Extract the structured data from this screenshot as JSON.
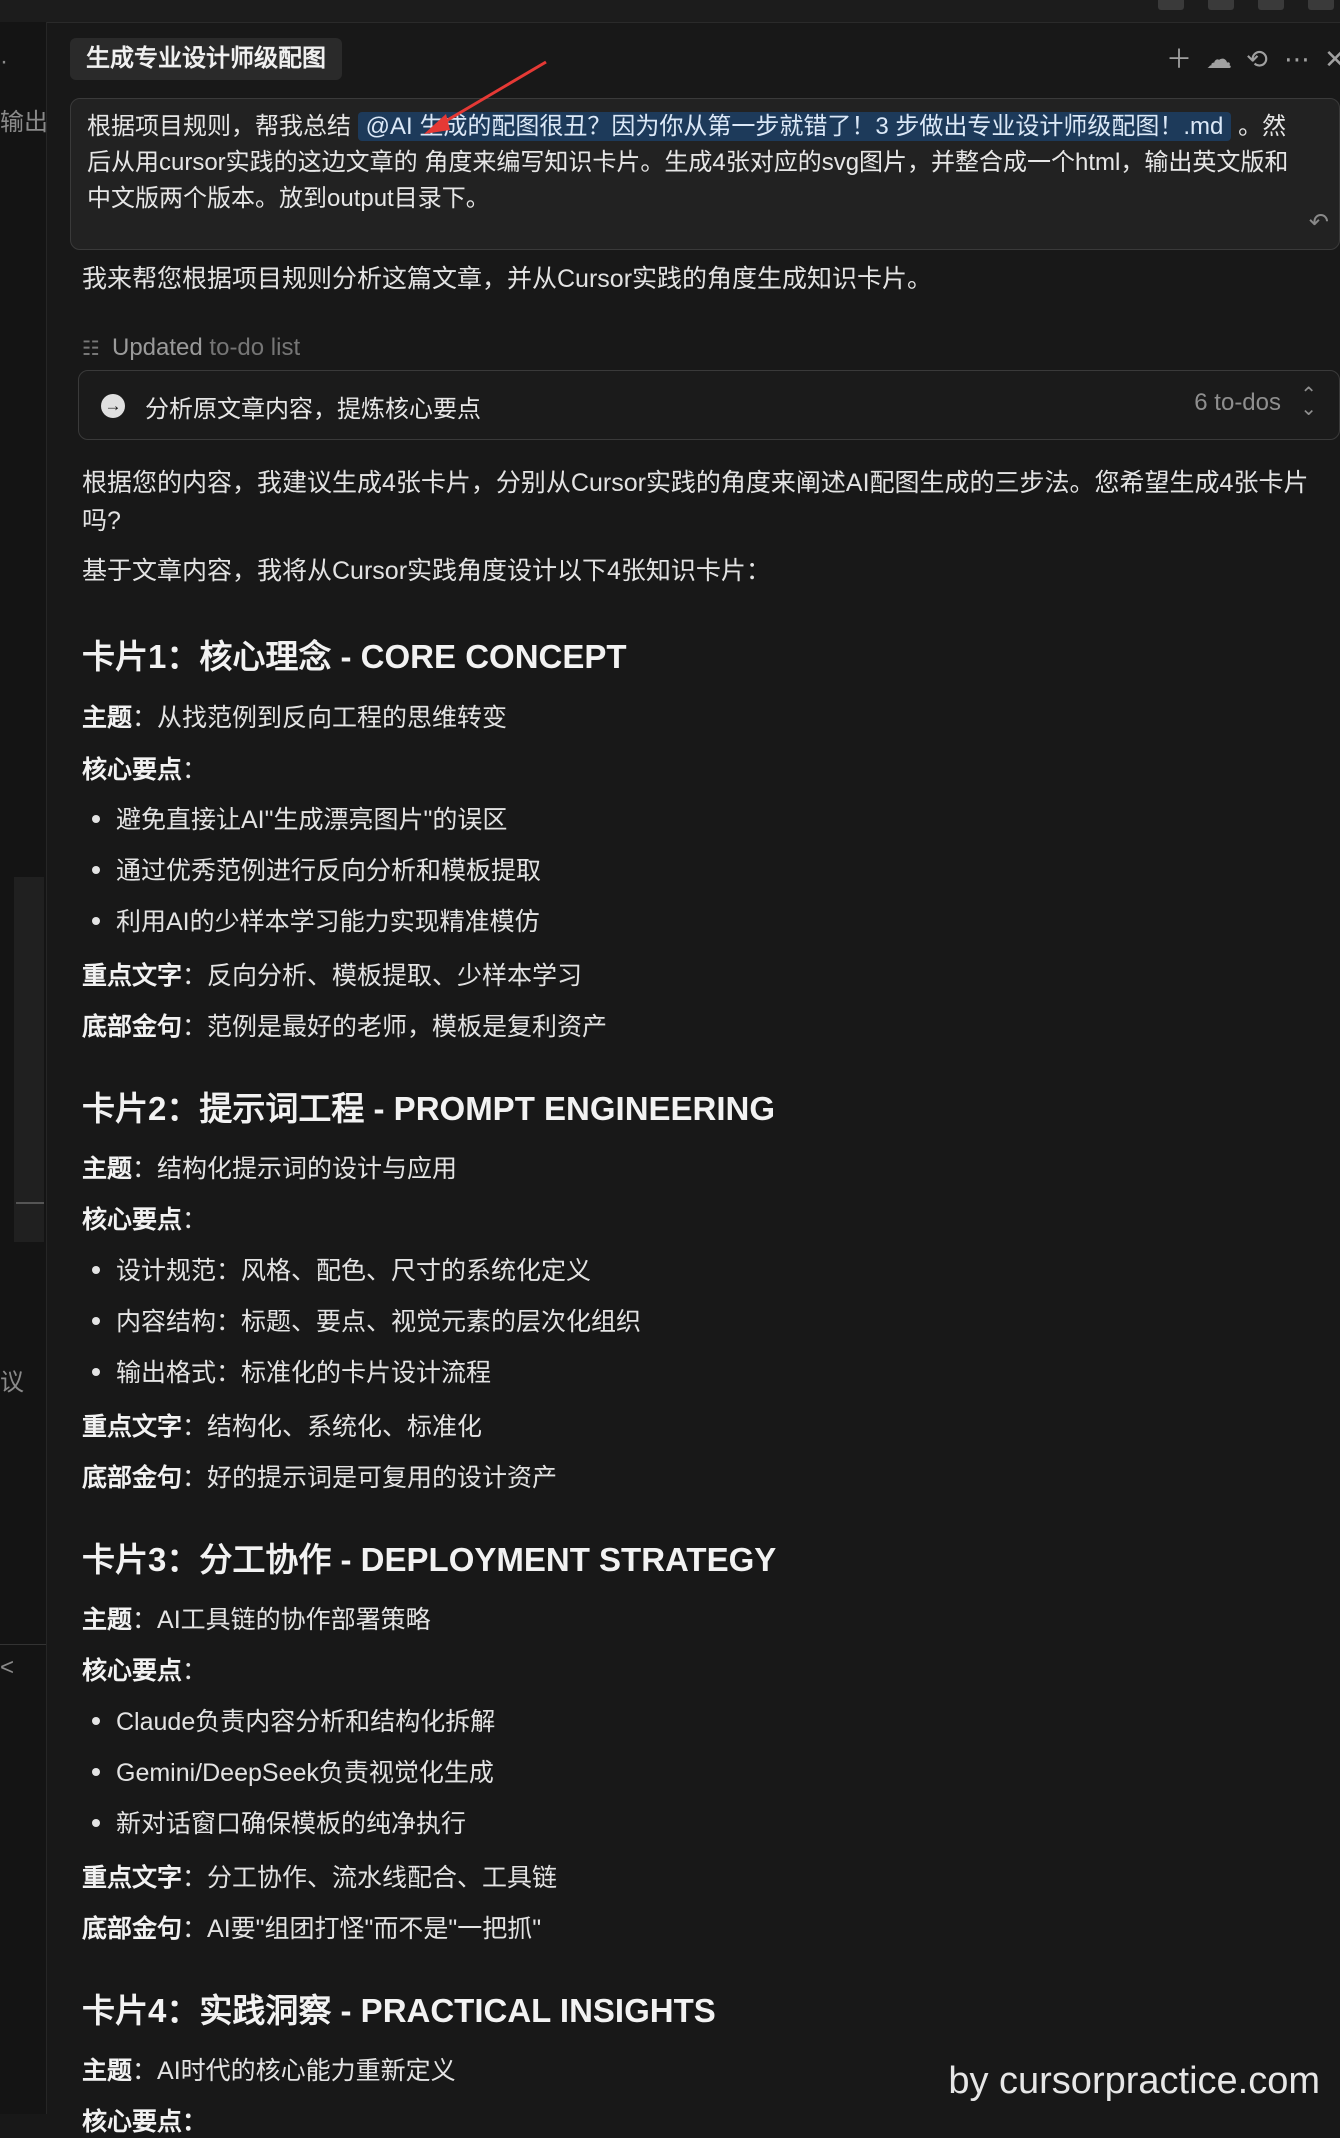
{
  "left_fragments": [
    "·",
    "输出",
    "议",
    "<"
  ],
  "tab_title": "生成专业设计师级配图",
  "header_icons": [
    "plus-icon",
    "cloud-icon",
    "history-icon",
    "more-icon",
    "close-icon"
  ],
  "user_message": {
    "before": "根据项目规则，帮我总结 ",
    "mention": "@AI 生成的配图很丑？因为你从第一步就错了！3 步做出专业设计师级配图！.md",
    "after": " 。然后从用cursor实践的这边文章的 角度来编写知识卡片。生成4张对应的svg图片，并整合成一个html，输出英文版和中文版两个版本。放到output目录下。"
  },
  "reply_intro": "我来帮您根据项目规则分析这篇文章，并从Cursor实践的角度生成知识卡片。",
  "updated": {
    "label": "Updated",
    "target": "to-do list"
  },
  "todo": {
    "label": "分析原文章内容，提炼核心要点",
    "count": "6 to-dos"
  },
  "para1": "根据您的内容，我建议生成4张卡片，分别从Cursor实践的角度来阐述AI配图生成的三步法。您希望生成4张卡片吗?",
  "para2": "基于文章内容，我将从Cursor实践角度设计以下4张知识卡片：",
  "labels": {
    "theme": "主题",
    "points": "核心要点",
    "keywords": "重点文字",
    "quote": "底部金句"
  },
  "cards": [
    {
      "title": "卡片1：核心理念 - CORE CONCEPT",
      "theme": "：从找范例到反向工程的思维转变",
      "points": [
        "避免直接让AI\"生成漂亮图片\"的误区",
        "通过优秀范例进行反向分析和模板提取",
        "利用AI的少样本学习能力实现精准模仿"
      ],
      "keywords": "：反向分析、模板提取、少样本学习",
      "quote": "：范例是最好的老师，模板是复利资产"
    },
    {
      "title": "卡片2：提示词工程 - PROMPT ENGINEERING",
      "theme": "：结构化提示词的设计与应用",
      "points": [
        "设计规范：风格、配色、尺寸的系统化定义",
        "内容结构：标题、要点、视觉元素的层次化组织",
        "输出格式：标准化的卡片设计流程"
      ],
      "keywords": "：结构化、系统化、标准化",
      "quote": "：好的提示词是可复用的设计资产"
    },
    {
      "title": "卡片3：分工协作 - DEPLOYMENT STRATEGY",
      "theme": "：AI工具链的协作部署策略",
      "points": [
        "Claude负责内容分析和结构化拆解",
        "Gemini/DeepSeek负责视觉化生成",
        "新对话窗口确保模板的纯净执行"
      ],
      "keywords": "：分工协作、流水线配合、工具链",
      "quote": "：AI要\"组团打怪\"而不是\"一把抓\""
    },
    {
      "title": "卡片4：实践洞察 - PRACTICAL INSIGHTS",
      "theme": "：AI时代的核心能力重新定义",
      "points_label_partial": "核心要点："
    }
  ],
  "watermark": "by cursorpractice.com"
}
